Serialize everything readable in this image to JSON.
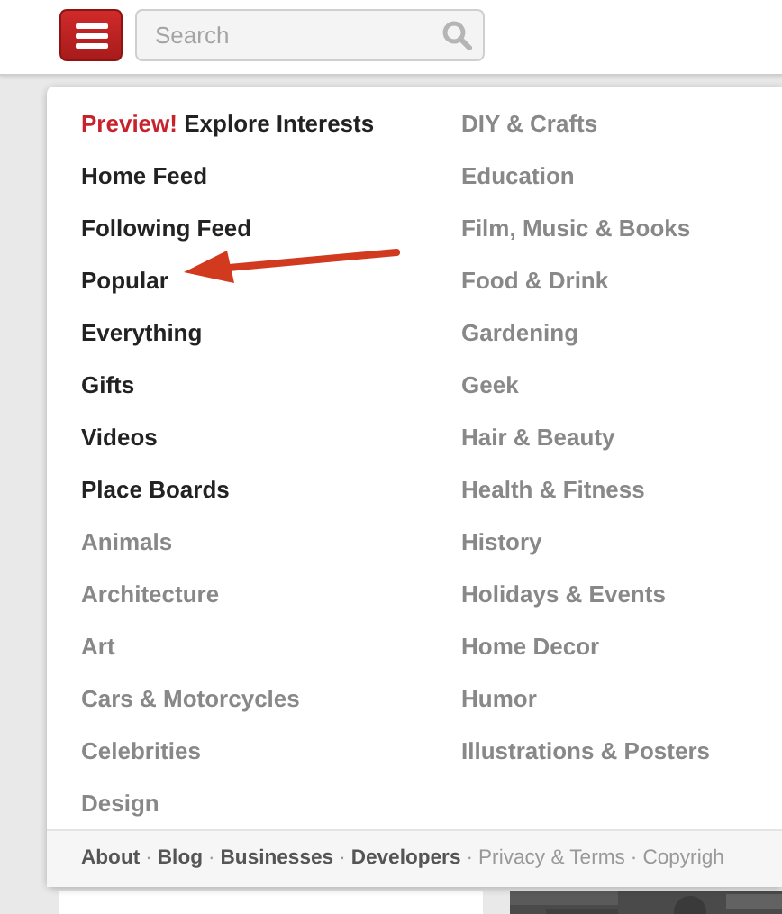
{
  "header": {
    "search": {
      "placeholder": "Search"
    }
  },
  "menu": {
    "heading": {
      "tag": "Preview!",
      "text": "Explore Interests"
    },
    "left": [
      {
        "label": "Home Feed",
        "kind": "featured"
      },
      {
        "label": "Following Feed",
        "kind": "featured"
      },
      {
        "label": "Popular",
        "kind": "featured"
      },
      {
        "label": "Everything",
        "kind": "featured"
      },
      {
        "label": "Gifts",
        "kind": "featured"
      },
      {
        "label": "Videos",
        "kind": "featured"
      },
      {
        "label": "Place Boards",
        "kind": "featured"
      },
      {
        "label": "Animals",
        "kind": "category"
      },
      {
        "label": "Architecture",
        "kind": "category"
      },
      {
        "label": "Art",
        "kind": "category"
      },
      {
        "label": "Cars & Motorcycles",
        "kind": "category"
      },
      {
        "label": "Celebrities",
        "kind": "category"
      },
      {
        "label": "Design",
        "kind": "category"
      }
    ],
    "right": [
      {
        "label": "DIY & Crafts",
        "kind": "category"
      },
      {
        "label": "Education",
        "kind": "category"
      },
      {
        "label": "Film, Music & Books",
        "kind": "category"
      },
      {
        "label": "Food & Drink",
        "kind": "category"
      },
      {
        "label": "Gardening",
        "kind": "category"
      },
      {
        "label": "Geek",
        "kind": "category"
      },
      {
        "label": "Hair & Beauty",
        "kind": "category"
      },
      {
        "label": "Health & Fitness",
        "kind": "category"
      },
      {
        "label": "History",
        "kind": "category"
      },
      {
        "label": "Holidays & Events",
        "kind": "category"
      },
      {
        "label": "Home Decor",
        "kind": "category"
      },
      {
        "label": "Humor",
        "kind": "category"
      },
      {
        "label": "Illustrations & Posters",
        "kind": "category"
      }
    ],
    "footer": [
      {
        "label": "About",
        "kind": "primary"
      },
      {
        "label": "·",
        "kind": "separator"
      },
      {
        "label": "Blog",
        "kind": "primary"
      },
      {
        "label": "·",
        "kind": "separator"
      },
      {
        "label": "Businesses",
        "kind": "primary"
      },
      {
        "label": "·",
        "kind": "separator"
      },
      {
        "label": "Developers",
        "kind": "primary"
      },
      {
        "label": "·",
        "kind": "separator"
      },
      {
        "label": "Privacy & Terms",
        "kind": "secondary"
      },
      {
        "label": "·",
        "kind": "separator"
      },
      {
        "label": "Copyrigh",
        "kind": "secondary"
      }
    ]
  }
}
